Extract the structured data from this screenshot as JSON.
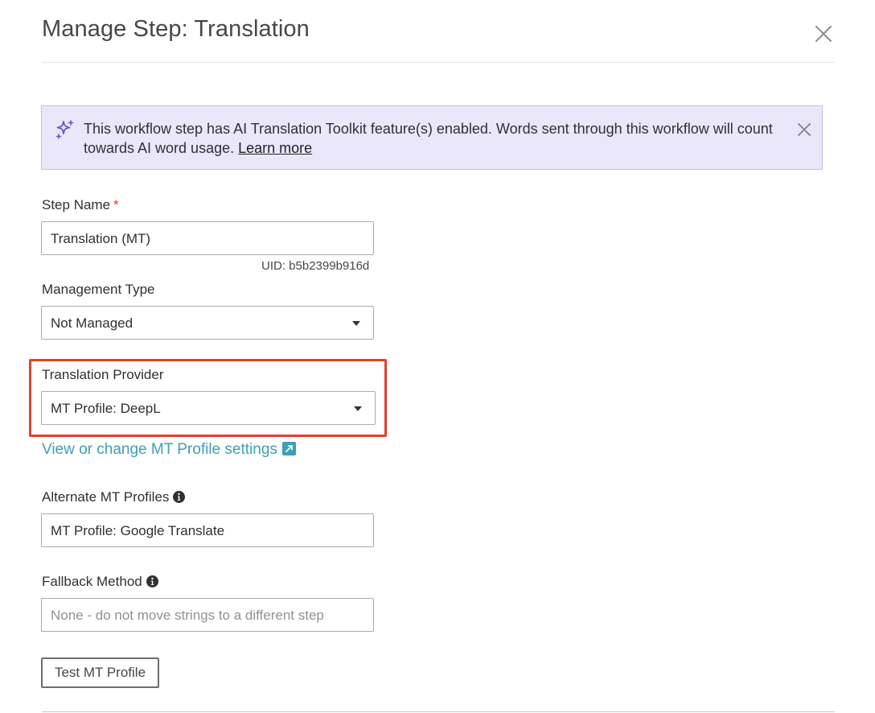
{
  "header": {
    "title": "Manage Step: Translation",
    "close_icon": "close-icon"
  },
  "banner": {
    "icon": "sparkles-icon",
    "text": "This workflow step has AI Translation Toolkit feature(s) enabled. Words sent through this workflow will count towards AI word usage.",
    "link_label": "Learn more",
    "close_icon": "close-icon",
    "background": "#ebe7fb",
    "border": "#c4bcef"
  },
  "form": {
    "step_name": {
      "label": "Step Name",
      "required_marker": "*",
      "value": "Translation (MT)",
      "uid": "UID: b5b2399b916d"
    },
    "management_type": {
      "label": "Management Type",
      "value": "Not Managed"
    },
    "translation_provider": {
      "label": "Translation Provider",
      "value": "MT Profile: DeepL",
      "highlight_color": "#e3412b"
    },
    "mt_profile_link": {
      "label": "View or change MT Profile settings",
      "icon": "external-link-icon",
      "color": "#3da0b8"
    },
    "alternate_profiles": {
      "label": "Alternate MT Profiles",
      "icon": "info-icon",
      "value": "MT Profile: Google Translate"
    },
    "fallback_method": {
      "label": "Fallback Method",
      "icon": "info-icon",
      "placeholder": "None - do not move strings to a different step"
    },
    "test_button_label": "Test MT Profile"
  }
}
